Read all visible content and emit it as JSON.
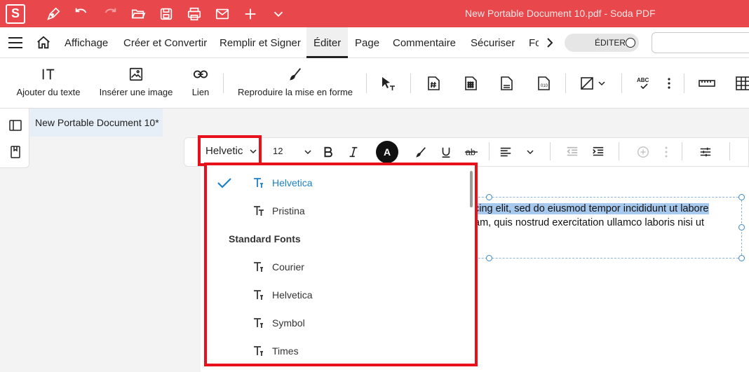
{
  "app": {
    "logo": "S",
    "window_title": "New Portable Document 10.pdf   -   Soda PDF"
  },
  "titlebar_icons": [
    "pen-icon",
    "undo-icon",
    "redo-icon",
    "open-folder-icon",
    "save-icon",
    "print-icon",
    "mail-icon",
    "plus-icon",
    "chevron-down-icon"
  ],
  "menu": {
    "items": [
      "Affichage",
      "Créer et Convertir",
      "Remplir et Signer",
      "Éditer",
      "Page",
      "Commentaire",
      "Sécuriser",
      "Fo"
    ],
    "active": "Éditer",
    "mode_toggle": "ÉDITER"
  },
  "ribbon": {
    "add_text": "Ajouter du texte",
    "insert_image": "Insérer une image",
    "link": "Lien",
    "format_painter": "Reproduire la mise en forme"
  },
  "document_tab": "New Portable Document 10*",
  "format_toolbar": {
    "font": "Helvetic",
    "size": "12",
    "color_letter": "A"
  },
  "document_text": {
    "line1_highlighted": "cing elit, sed do eiusmod tempor incididunt ut labore",
    "line2": "am, quis nostrud exercitation ullamco laboris nisi ut"
  },
  "font_dropdown": {
    "recent": [
      {
        "label": "Helvetica",
        "selected": true
      },
      {
        "label": "Pristina",
        "selected": false
      }
    ],
    "standard_header": "Standard Fonts",
    "standard": [
      "Courier",
      "Helvetica",
      "Symbol",
      "Times"
    ]
  },
  "colors": {
    "brand_red": "#e8484b",
    "highlight_red": "#e8101a",
    "selected_blue": "#1b7fc9",
    "text_highlight": "#a8c9ee"
  }
}
